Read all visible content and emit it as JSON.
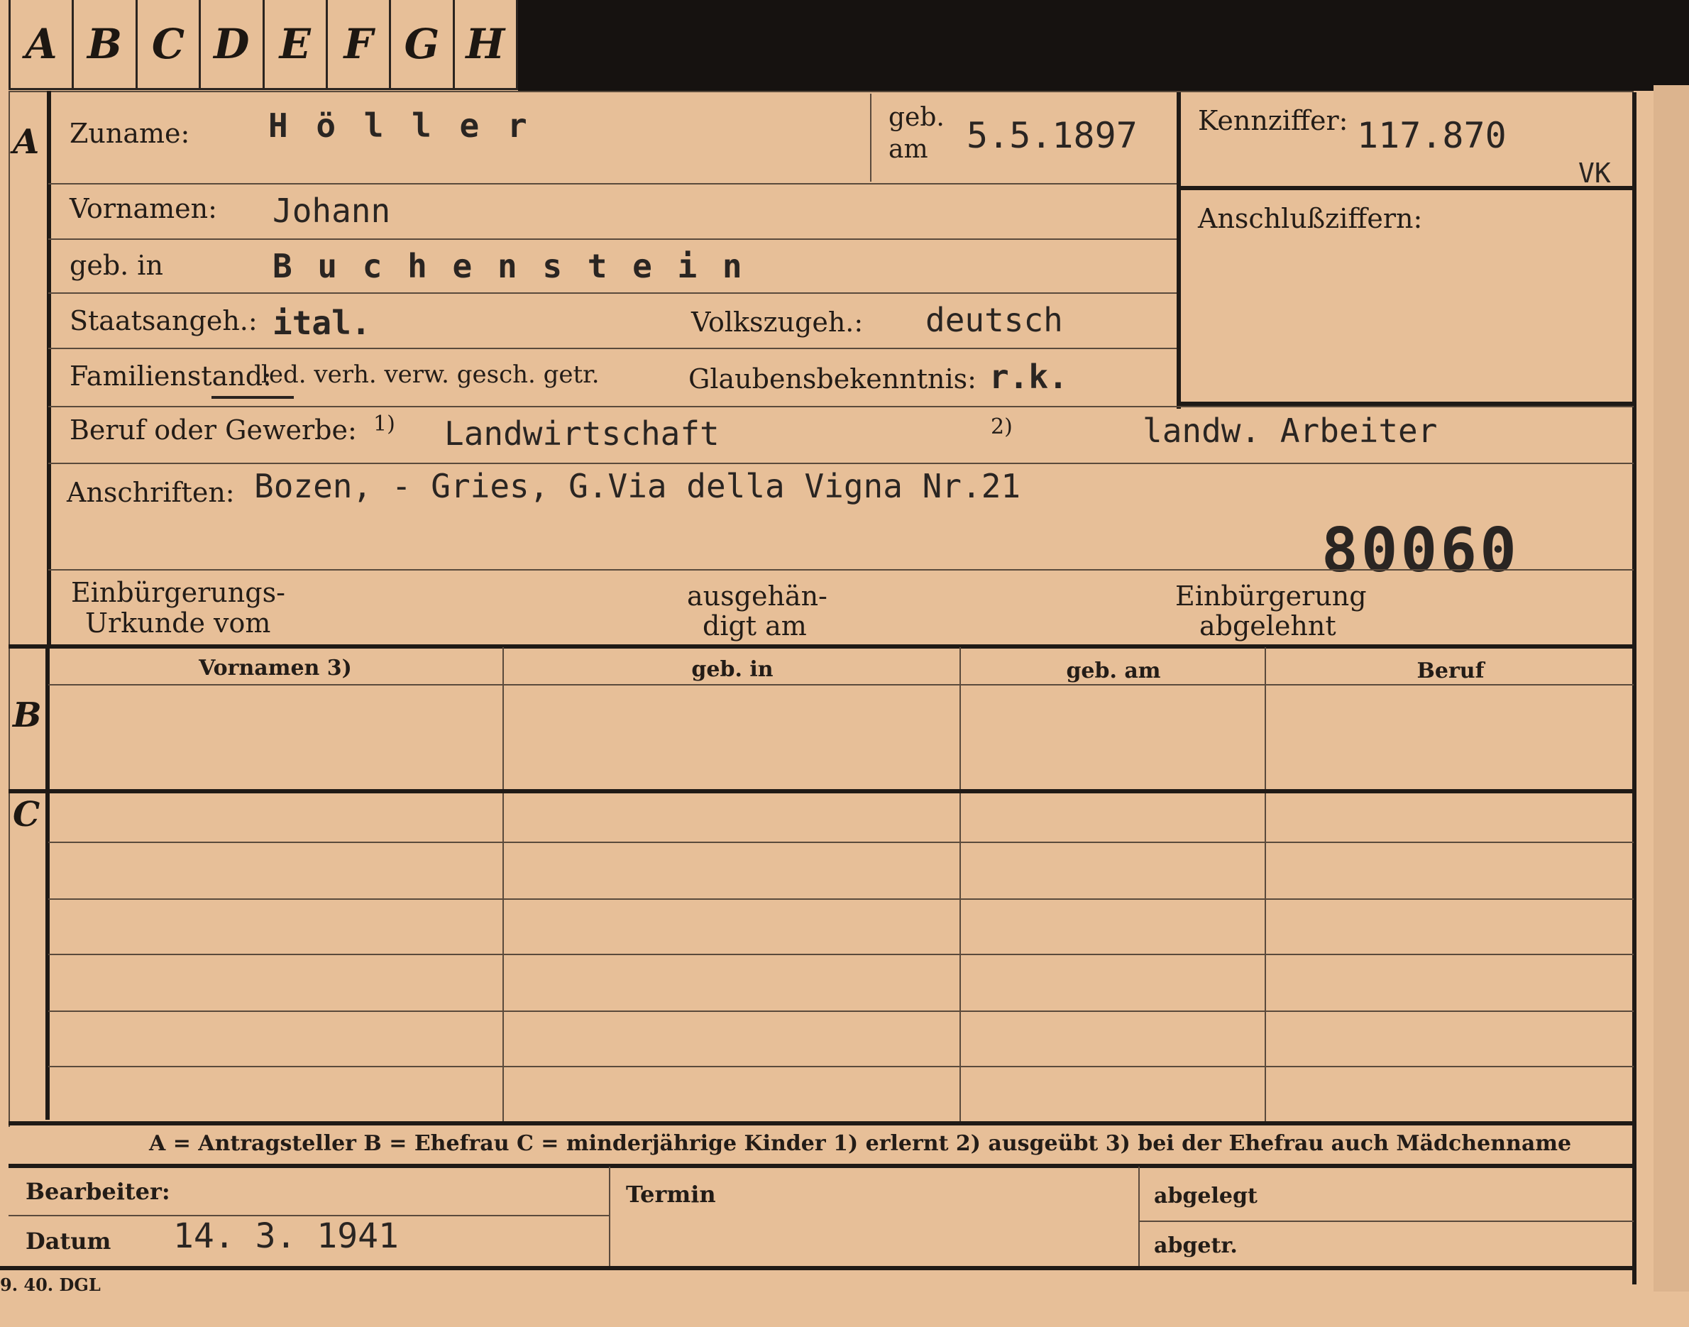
{
  "tabs": [
    "A",
    "B",
    "C",
    "D",
    "E",
    "F",
    "G",
    "H"
  ],
  "section_letters": {
    "a": "A",
    "b": "B",
    "c": "C"
  },
  "person": {
    "zuname_label": "Zuname:",
    "zuname_value": "H ö l l e r",
    "geb_am_label_1": "geb.",
    "geb_am_label_2": "am",
    "geb_am_value": "5.5.1897",
    "vornamen_label": "Vornamen:",
    "vornamen_value": "Johann",
    "geb_in_label": "geb. in",
    "geb_in_value": "B u c h e n s t e i n",
    "staatsangeh_label": "Staatsangeh.:",
    "staatsangeh_value": "ital.",
    "volkszugeh_label": "Volkszugeh.:",
    "volkszugeh_value": "deutsch",
    "familienstand_label": "Familienstand:",
    "familienstand_options": "led. verh. verw. gesch. getr.",
    "glaubens_label": "Glaubensbekenntnis:",
    "glaubens_value": "r.k.",
    "beruf_label": "Beruf oder Gewerbe:",
    "beruf_note1": "1)",
    "beruf_value1": "Landwirtschaft",
    "beruf_note2": "2)",
    "beruf_value2": "landw. Arbeiter",
    "anschriften_label": "Anschriften:",
    "anschriften_value": "Bozen, - Gries, G.Via  della Vigna Nr.21",
    "stamp_number": "80060",
    "einbuergerung_urkunde_1": "Einbürgerungs-",
    "einbuergerung_urkunde_2": "Urkunde vom",
    "ausgehaendigt_1": "ausgehän-",
    "ausgehaendigt_2": "digt am",
    "einbuergerung_abgelehnt_1": "Einbürgerung",
    "einbuergerung_abgelehnt_2": "abgelehnt"
  },
  "kennziffer": {
    "label": "Kennziffer:",
    "value": "117.870",
    "suffix": "VK",
    "anschluss_label": "Anschlußziffern:"
  },
  "table": {
    "headers": [
      "Vornamen 3)",
      "geb. in",
      "geb. am",
      "Beruf"
    ]
  },
  "legend": {
    "text": "A = Antragsteller   B = Ehefrau   C = minderjährige Kinder   1) erlernt   2) ausgeübt   3) bei der Ehefrau auch Mädchenname"
  },
  "footer": {
    "bearbeiter_label": "Bearbeiter:",
    "datum_label": "Datum",
    "datum_value": "14.  3.  1941",
    "termin_label": "Termin",
    "abgelegt_label": "abgelegt",
    "abgetr_label": "abgetr.",
    "print_code": "9. 40. DGL"
  }
}
